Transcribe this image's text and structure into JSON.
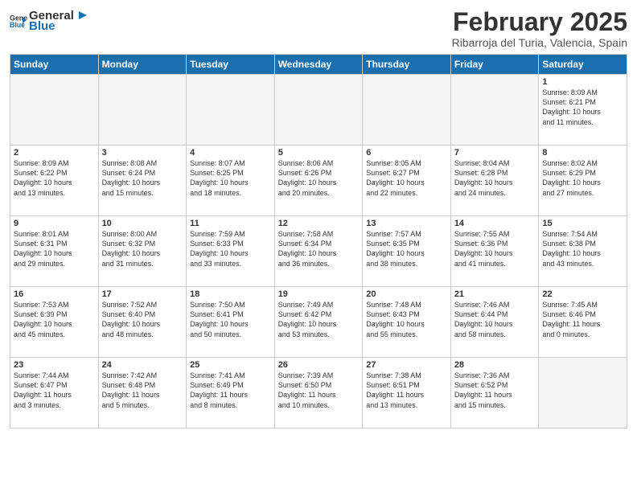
{
  "logo": {
    "general": "General",
    "blue": "Blue"
  },
  "title": "February 2025",
  "subtitle": "Ribarroja del Turia, Valencia, Spain",
  "days_of_week": [
    "Sunday",
    "Monday",
    "Tuesday",
    "Wednesday",
    "Thursday",
    "Friday",
    "Saturday"
  ],
  "weeks": [
    [
      {
        "day": "",
        "detail": ""
      },
      {
        "day": "",
        "detail": ""
      },
      {
        "day": "",
        "detail": ""
      },
      {
        "day": "",
        "detail": ""
      },
      {
        "day": "",
        "detail": ""
      },
      {
        "day": "",
        "detail": ""
      },
      {
        "day": "1",
        "detail": "Sunrise: 8:09 AM\nSunset: 6:21 PM\nDaylight: 10 hours\nand 11 minutes."
      }
    ],
    [
      {
        "day": "2",
        "detail": "Sunrise: 8:09 AM\nSunset: 6:22 PM\nDaylight: 10 hours\nand 13 minutes."
      },
      {
        "day": "3",
        "detail": "Sunrise: 8:08 AM\nSunset: 6:24 PM\nDaylight: 10 hours\nand 15 minutes."
      },
      {
        "day": "4",
        "detail": "Sunrise: 8:07 AM\nSunset: 6:25 PM\nDaylight: 10 hours\nand 18 minutes."
      },
      {
        "day": "5",
        "detail": "Sunrise: 8:06 AM\nSunset: 6:26 PM\nDaylight: 10 hours\nand 20 minutes."
      },
      {
        "day": "6",
        "detail": "Sunrise: 8:05 AM\nSunset: 6:27 PM\nDaylight: 10 hours\nand 22 minutes."
      },
      {
        "day": "7",
        "detail": "Sunrise: 8:04 AM\nSunset: 6:28 PM\nDaylight: 10 hours\nand 24 minutes."
      },
      {
        "day": "8",
        "detail": "Sunrise: 8:02 AM\nSunset: 6:29 PM\nDaylight: 10 hours\nand 27 minutes."
      }
    ],
    [
      {
        "day": "9",
        "detail": "Sunrise: 8:01 AM\nSunset: 6:31 PM\nDaylight: 10 hours\nand 29 minutes."
      },
      {
        "day": "10",
        "detail": "Sunrise: 8:00 AM\nSunset: 6:32 PM\nDaylight: 10 hours\nand 31 minutes."
      },
      {
        "day": "11",
        "detail": "Sunrise: 7:59 AM\nSunset: 6:33 PM\nDaylight: 10 hours\nand 33 minutes."
      },
      {
        "day": "12",
        "detail": "Sunrise: 7:58 AM\nSunset: 6:34 PM\nDaylight: 10 hours\nand 36 minutes."
      },
      {
        "day": "13",
        "detail": "Sunrise: 7:57 AM\nSunset: 6:35 PM\nDaylight: 10 hours\nand 38 minutes."
      },
      {
        "day": "14",
        "detail": "Sunrise: 7:55 AM\nSunset: 6:36 PM\nDaylight: 10 hours\nand 41 minutes."
      },
      {
        "day": "15",
        "detail": "Sunrise: 7:54 AM\nSunset: 6:38 PM\nDaylight: 10 hours\nand 43 minutes."
      }
    ],
    [
      {
        "day": "16",
        "detail": "Sunrise: 7:53 AM\nSunset: 6:39 PM\nDaylight: 10 hours\nand 45 minutes."
      },
      {
        "day": "17",
        "detail": "Sunrise: 7:52 AM\nSunset: 6:40 PM\nDaylight: 10 hours\nand 48 minutes."
      },
      {
        "day": "18",
        "detail": "Sunrise: 7:50 AM\nSunset: 6:41 PM\nDaylight: 10 hours\nand 50 minutes."
      },
      {
        "day": "19",
        "detail": "Sunrise: 7:49 AM\nSunset: 6:42 PM\nDaylight: 10 hours\nand 53 minutes."
      },
      {
        "day": "20",
        "detail": "Sunrise: 7:48 AM\nSunset: 6:43 PM\nDaylight: 10 hours\nand 55 minutes."
      },
      {
        "day": "21",
        "detail": "Sunrise: 7:46 AM\nSunset: 6:44 PM\nDaylight: 10 hours\nand 58 minutes."
      },
      {
        "day": "22",
        "detail": "Sunrise: 7:45 AM\nSunset: 6:46 PM\nDaylight: 11 hours\nand 0 minutes."
      }
    ],
    [
      {
        "day": "23",
        "detail": "Sunrise: 7:44 AM\nSunset: 6:47 PM\nDaylight: 11 hours\nand 3 minutes."
      },
      {
        "day": "24",
        "detail": "Sunrise: 7:42 AM\nSunset: 6:48 PM\nDaylight: 11 hours\nand 5 minutes."
      },
      {
        "day": "25",
        "detail": "Sunrise: 7:41 AM\nSunset: 6:49 PM\nDaylight: 11 hours\nand 8 minutes."
      },
      {
        "day": "26",
        "detail": "Sunrise: 7:39 AM\nSunset: 6:50 PM\nDaylight: 11 hours\nand 10 minutes."
      },
      {
        "day": "27",
        "detail": "Sunrise: 7:38 AM\nSunset: 6:51 PM\nDaylight: 11 hours\nand 13 minutes."
      },
      {
        "day": "28",
        "detail": "Sunrise: 7:36 AM\nSunset: 6:52 PM\nDaylight: 11 hours\nand 15 minutes."
      },
      {
        "day": "",
        "detail": ""
      }
    ]
  ]
}
